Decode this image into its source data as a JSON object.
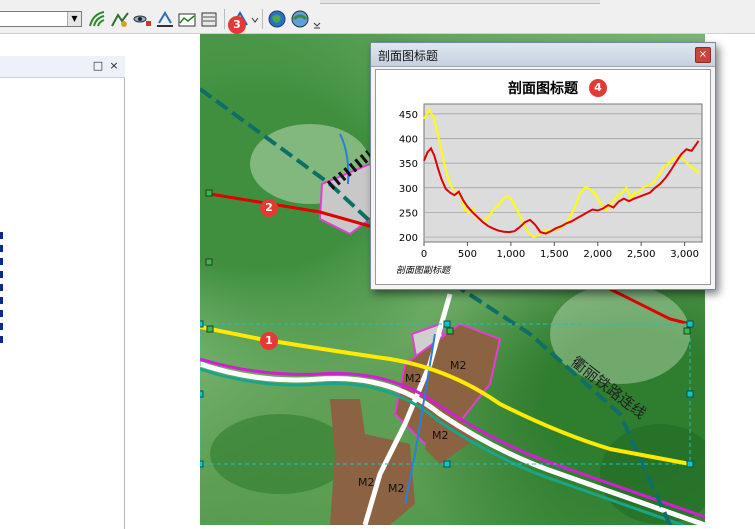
{
  "toolbar": {
    "badge": "3",
    "icons": [
      "combo-dropdown",
      "contour-tool",
      "slope-tool",
      "viewshed-tool",
      "interpolate-line-tool",
      "profile-graph-tool",
      "line-of-sight-tool",
      "steepest-path-tool",
      "globe-tool",
      "globe-view-tool"
    ]
  },
  "panel": {
    "dock_label": "□",
    "close_label": "×"
  },
  "map": {
    "badge_yellow_line": "1",
    "badge_red_line": "2",
    "landuse_labels": [
      "M2",
      "M2",
      "M2",
      "M2",
      "M2"
    ],
    "railway_label": "衢丽铁路连线",
    "colors": {
      "yellow_line": "#ffea00",
      "red_line": "#e00000",
      "railway": "#0f6f66",
      "landuse_fill": "#8b6342"
    }
  },
  "graph_window": {
    "title": "剖面图标题",
    "close_label": "×",
    "badge": "4",
    "chart_title": "剖面图标题",
    "subtitle": "剖面图副标题"
  },
  "chart_data": {
    "type": "line",
    "title": "剖面图标题",
    "subtitle": "剖面图副标题",
    "xlabel": "",
    "ylabel": "",
    "xlim": [
      0,
      3200
    ],
    "ylim": [
      190,
      470
    ],
    "x_ticks": [
      "0",
      "500",
      "1,000",
      "1,500",
      "2,000",
      "2,500",
      "3,000"
    ],
    "y_ticks": [
      "200",
      "250",
      "300",
      "350",
      "400",
      "450"
    ],
    "grid": true,
    "series": [
      {
        "color": "#ffff00",
        "x": [
          0,
          60,
          120,
          200,
          260,
          320,
          380,
          430,
          470,
          520,
          560,
          600,
          650,
          700,
          760,
          810,
          860,
          900,
          950,
          1000,
          1050,
          1100,
          1150,
          1200,
          1260,
          1320,
          1380,
          1440,
          1500,
          1560,
          1620,
          1680,
          1740,
          1800,
          1860,
          1920,
          1980,
          2040,
          2100,
          2160,
          2220,
          2280,
          2330,
          2380,
          2430,
          2480,
          2530,
          2580,
          2640,
          2700,
          2760,
          2820,
          2880,
          2940,
          3000,
          3060,
          3120,
          3160
        ],
        "values": [
          440,
          458,
          440,
          375,
          330,
          300,
          290,
          280,
          255,
          250,
          258,
          240,
          235,
          230,
          245,
          258,
          265,
          275,
          283,
          278,
          262,
          245,
          225,
          210,
          200,
          205,
          212,
          215,
          214,
          218,
          225,
          240,
          262,
          290,
          302,
          296,
          285,
          265,
          255,
          270,
          282,
          290,
          300,
          280,
          290,
          292,
          302,
          305,
          310,
          325,
          342,
          350,
          360,
          365,
          355,
          345,
          336,
          330
        ]
      },
      {
        "color": "#e00000",
        "x": [
          0,
          40,
          80,
          120,
          160,
          200,
          250,
          300,
          350,
          400,
          450,
          500,
          560,
          620,
          680,
          740,
          800,
          860,
          920,
          980,
          1040,
          1100,
          1160,
          1220,
          1280,
          1340,
          1400,
          1460,
          1520,
          1580,
          1640,
          1700,
          1760,
          1820,
          1880,
          1940,
          2000,
          2060,
          2120,
          2180,
          2240,
          2300,
          2360,
          2420,
          2480,
          2540,
          2600,
          2660,
          2720,
          2780,
          2840,
          2900,
          2960,
          3020,
          3080,
          3120,
          3160
        ],
        "values": [
          355,
          372,
          380,
          365,
          340,
          318,
          298,
          290,
          285,
          292,
          275,
          262,
          250,
          240,
          230,
          222,
          217,
          213,
          211,
          210,
          212,
          220,
          230,
          235,
          225,
          210,
          207,
          212,
          218,
          222,
          228,
          232,
          238,
          244,
          250,
          256,
          254,
          258,
          265,
          260,
          272,
          278,
          273,
          278,
          282,
          286,
          290,
          300,
          308,
          320,
          335,
          352,
          368,
          378,
          375,
          385,
          395
        ]
      }
    ]
  }
}
